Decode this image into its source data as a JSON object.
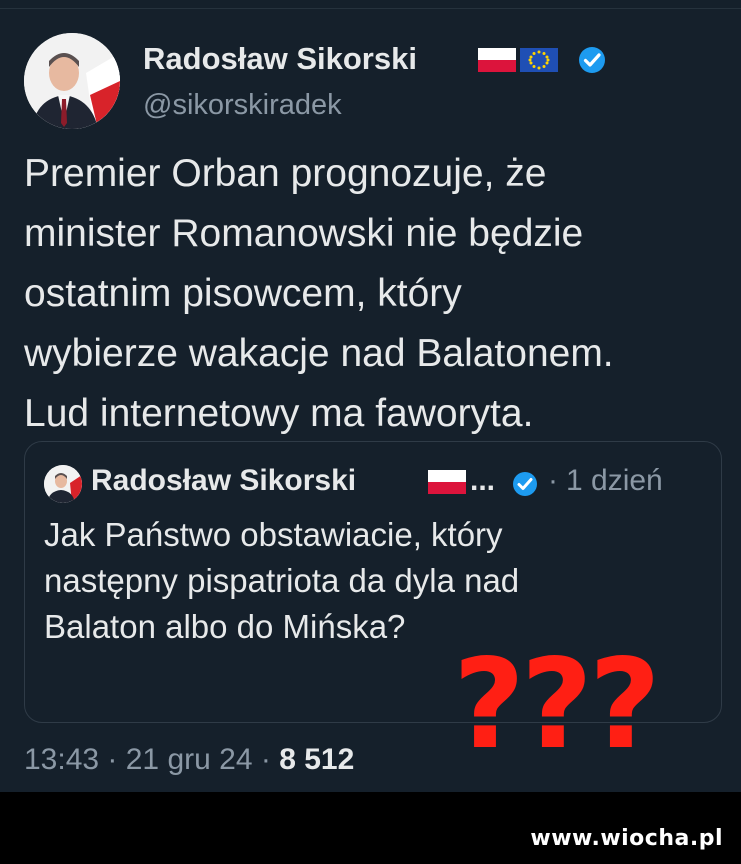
{
  "author": {
    "name": "Radosław Sikorski",
    "handle": "@sikorskiradek"
  },
  "tweet": {
    "lines": [
      "Premier Orban prognozuje, że",
      "minister Romanowski nie będzie",
      "ostatnim pisowcem, który",
      "wybierze wakacje nad Balatonem.",
      "Lud internetowy ma faworyta."
    ]
  },
  "quoted": {
    "name": "Radosław Sikorski",
    "ellipsis": "...",
    "separator": "·",
    "time": "1 dzień",
    "lines": [
      "Jak Państwo obstawiacie, który",
      "następny pispatriota da dyla nad",
      "Balaton albo do Mińska?"
    ]
  },
  "meta": {
    "time": "13:43",
    "sep1": " · ",
    "date": "21 gru 24",
    "sep2": " · ",
    "views": "8 512"
  },
  "overlay": {
    "question_marks": "???"
  },
  "watermark": "www.wiocha.pl",
  "colors": {
    "background": "#15202b",
    "text": "#e7e9ea",
    "secondary": "#8b98a5",
    "verified": "#1d9bf0",
    "overlay_red": "#ff1f14"
  }
}
